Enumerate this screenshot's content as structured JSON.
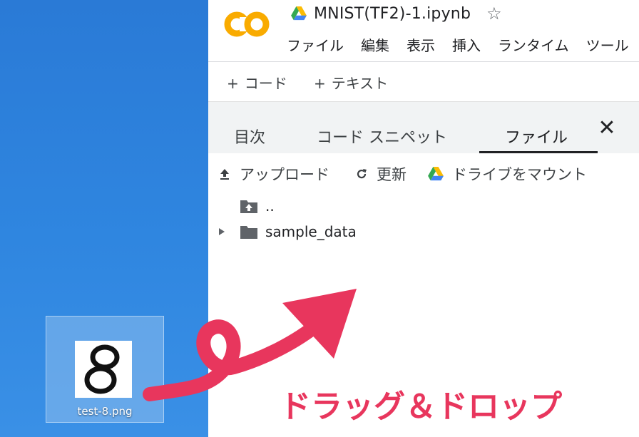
{
  "notebook": {
    "title": "MNIST(TF2)-1.ipynb",
    "logo_text": "CO"
  },
  "menu": [
    "ファイル",
    "編集",
    "表示",
    "挿入",
    "ランタイム",
    "ツール"
  ],
  "toolbar": {
    "add_code": "コード",
    "add_text": "テキスト",
    "plus": "+"
  },
  "panel": {
    "tabs": [
      "目次",
      "コード スニペット",
      "ファイル"
    ],
    "active_tab": "ファイル",
    "upload": "アップロード",
    "refresh": "更新",
    "mount_drive": "ドライブをマウント",
    "tree": [
      {
        "name": "..",
        "type": "parent-folder"
      },
      {
        "name": "sample_data",
        "type": "folder"
      }
    ]
  },
  "desktop": {
    "file_name": "test-8.png"
  },
  "overlay": {
    "caption": "ドラッグ＆ドロップ",
    "arrow_color": "#e8365d"
  },
  "colors": {
    "desktop_blue": "#2b7fd8",
    "colab_orange": "#f9ab00",
    "accent_pink": "#e8365d"
  }
}
